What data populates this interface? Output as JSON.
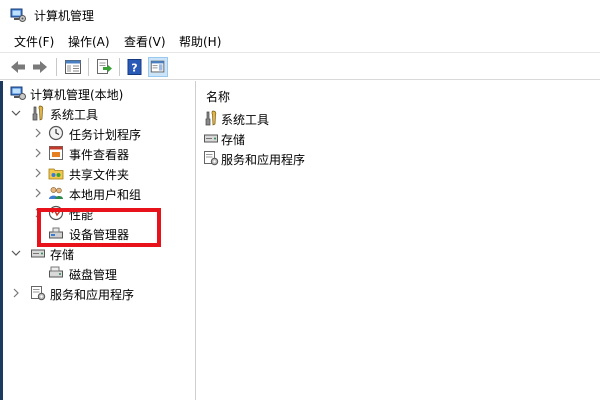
{
  "window": {
    "title": "计算机管理"
  },
  "menu": [
    {
      "label": "文件(F)"
    },
    {
      "label": "操作(A)"
    },
    {
      "label": "查看(V)"
    },
    {
      "label": "帮助(H)"
    }
  ],
  "toolbar": {
    "icons": [
      "back-arrow-icon",
      "forward-arrow-icon",
      "show-tree-icon",
      "export-list-icon",
      "help-icon",
      "show-action-pane-icon"
    ]
  },
  "tree": {
    "root": "计算机管理(本地)",
    "system_tools": "系统工具",
    "task_scheduler": "任务计划程序",
    "event_viewer": "事件查看器",
    "shared_folders": "共享文件夹",
    "local_users": "本地用户和组",
    "performance": "性能",
    "device_manager": "设备管理器",
    "storage": "存储",
    "disk_management": "磁盘管理",
    "services_apps": "服务和应用程序"
  },
  "content": {
    "column_header": "名称",
    "items": [
      {
        "label": "系统工具",
        "icon": "tools-icon"
      },
      {
        "label": "存储",
        "icon": "storage-icon"
      },
      {
        "label": "服务和应用程序",
        "icon": "services-icon"
      }
    ]
  },
  "colors": {
    "highlight": "#e8121a",
    "selection": "#cce4f7"
  }
}
